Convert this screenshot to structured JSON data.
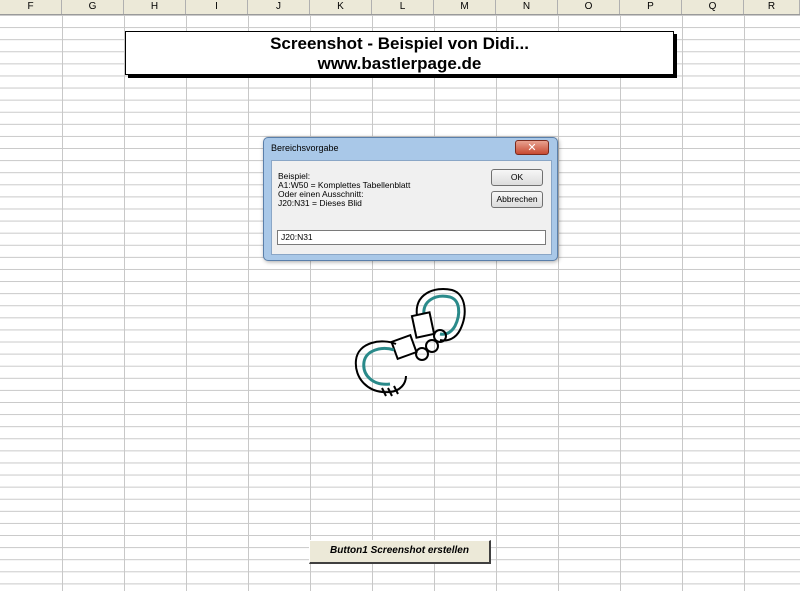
{
  "spreadsheet": {
    "columns": [
      "F",
      "G",
      "H",
      "I",
      "J",
      "K",
      "L",
      "M",
      "N",
      "O",
      "P",
      "Q",
      "R"
    ]
  },
  "title_box": {
    "line1": "Screenshot - Beispiel von Didi...",
    "line2": "www.bastlerpage.de"
  },
  "dialog": {
    "title": "Bereichsvorgabe",
    "close_icon": "close-x",
    "prompt_lines": [
      "Beispiel:",
      "A1:W50 = Komplettes Tabellenblatt",
      "Oder einen Ausschnitt:",
      "J20:N31 = Dieses Blid"
    ],
    "ok_label": "OK",
    "cancel_label": "Abbrechen",
    "input_value": "J20:N31"
  },
  "image": {
    "icon": "handcuffs-picture"
  },
  "macro_button": {
    "label": "Button1 Screenshot erstellen"
  },
  "colors": {
    "dialog_frame": "#a9c8e8",
    "close_button": "#c74a32",
    "grid": "#c8c8c8"
  }
}
